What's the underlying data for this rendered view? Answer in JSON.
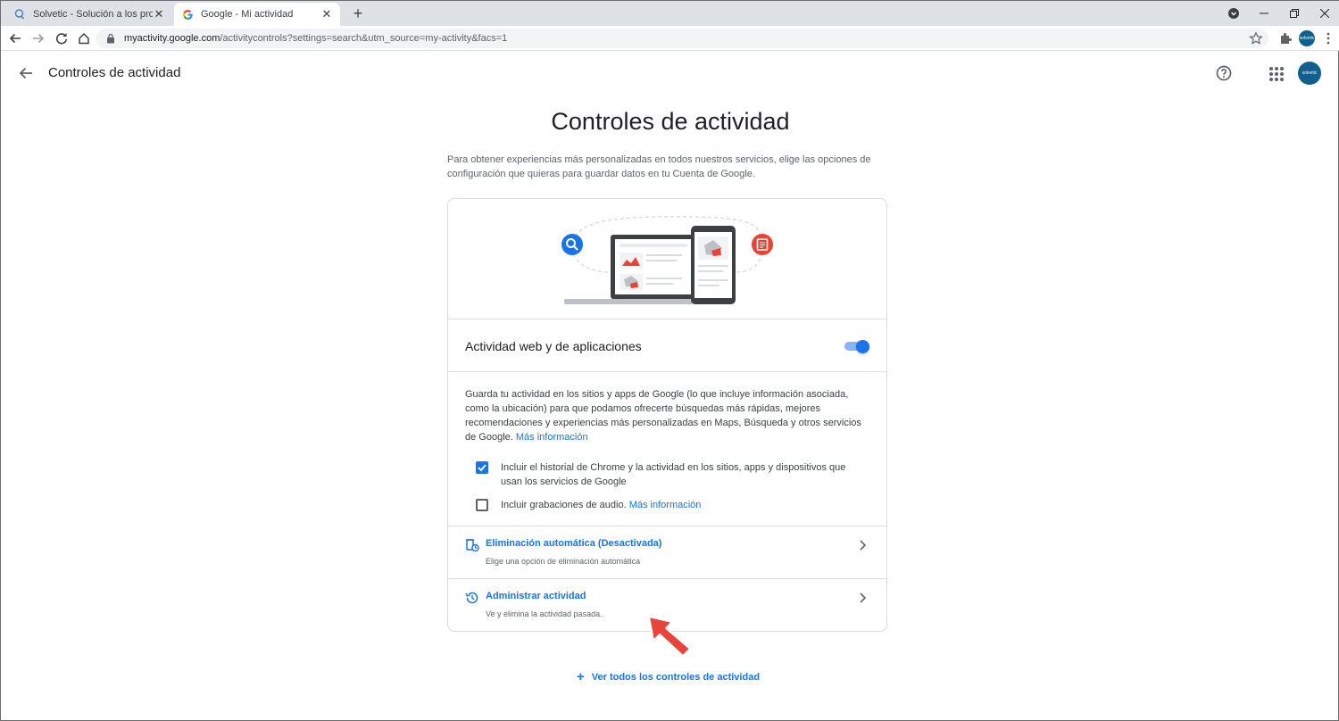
{
  "browser": {
    "tabs": [
      {
        "title": "Solvetic - Solución a los problem",
        "active": false,
        "icon": "solvetic-favicon"
      },
      {
        "title": "Google - Mi actividad",
        "active": true,
        "icon": "google-favicon"
      }
    ],
    "new_tab": "+",
    "address": {
      "host": "myactivity.google.com",
      "path": "/activitycontrols?settings=search&utm_source=my-activity&facs=1"
    },
    "profile_label": "solvetic"
  },
  "appbar": {
    "title": "Controles de actividad",
    "avatar_label": "solvetic"
  },
  "main": {
    "title": "Controles de actividad",
    "intro": "Para obtener experiencias más personalizadas en todos nuestros servicios, elige las opciones de configuración que quieras para guardar datos en tu Cuenta de Google."
  },
  "card": {
    "section_title": "Actividad web y de aplicaciones",
    "toggle_on": true,
    "description": "Guarda tu actividad en los sitios y apps de Google (lo que incluye información asociada, como la ubicación) para que podamos ofrecerte búsquedas más rápidas, mejores recomendaciones y experiencias más personalizadas en Maps, Búsqueda y otros servicios de Google.",
    "more_info": "Más información",
    "checkboxes": [
      {
        "label": "Incluir el historial de Chrome y la actividad en los sitios, apps y dispositivos que usan los servicios de Google",
        "checked": true,
        "link": ""
      },
      {
        "label": "Incluir grabaciones de audio.",
        "checked": false,
        "link": "Más información"
      }
    ],
    "rows": [
      {
        "title": "Eliminación automática (Desactivada)",
        "subtitle": "Elige una opción de eliminación automática",
        "icon": "auto-delete-icon"
      },
      {
        "title": "Administrar actividad",
        "subtitle": "Ve y elimina la actividad pasada.",
        "icon": "history-icon"
      }
    ]
  },
  "footer": {
    "see_all": "Ver todos los controles de actividad"
  },
  "colors": {
    "accent": "#1a73e8",
    "annotation_arrow": "#e8443a"
  }
}
